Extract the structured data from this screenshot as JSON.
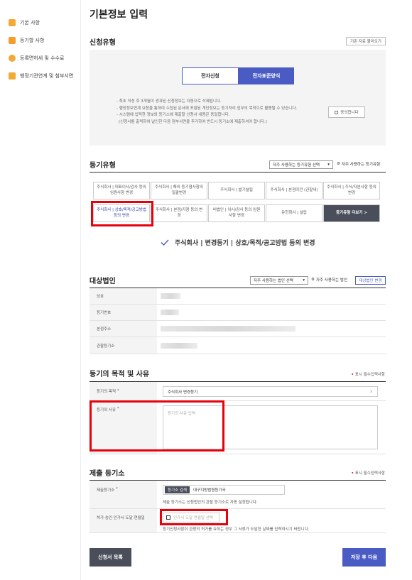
{
  "sidebar": {
    "items": [
      {
        "label": "기본 사항",
        "icon": "list-icon"
      },
      {
        "label": "등기할 사항",
        "icon": "pencil-icon"
      },
      {
        "label": "등록면허세 및 수수료",
        "icon": "coin-icon"
      },
      {
        "label": "행정기관연계 및 첨부서면",
        "icon": "attachment-icon"
      }
    ]
  },
  "page": {
    "title": "기본정보 입력"
  },
  "apply_type": {
    "title": "신청유형",
    "load_button": "기존 자료 불러오기",
    "tabs": [
      "전자신청",
      "전자표준양식"
    ],
    "selected_tab": "전자표준양식",
    "notices": [
      "- 최초 작성 후 3개월이 경과된 신청정보는 자동으로 삭제됩니다.",
      "- 행정정보연계 요청을 통하여 수집된 문서에 포함된 개인정보는 등기처리 업무의 목적으로 활용될 수 있습니다.",
      "- 시스템에 입력한 정보와 등기소에 제출할 신청서 내용은 동일합니다.",
      "(신청서를 출력하여 날인한 다음 첨부서면을 추가하여 반드시 등기소에 제출하셔야 합니다.)"
    ],
    "agree_button": "동의합니다"
  },
  "reg_type": {
    "title": "등기유형",
    "select_placeholder": "자주 사용하는 등기유형 선택",
    "favorite_label": "자주 사용하는 등기유형",
    "cells_row1": [
      "주식회사 | 대표이사/감사 등의 임원사항 변경",
      "주식회사 | 해외 등기형사항의 일괄변경",
      "주식회사 | 발기설립",
      "주식회사 | 본점이전 (관할내)",
      "주식회사 | 주식/자본사항 등의 변경"
    ],
    "cells_row2": [
      "주식회사 | 상호/목적/공고방법 등의 변경",
      "주식회사 | 본점/지점 등의 변경",
      "비법인 | 이사/감사 등의 임원사항 변경",
      "유한회사 | 설립",
      "등기유형 더보기 >"
    ],
    "selected": "주식회사 | 변경등기 | 상호/목적/공고방법 등의 변경"
  },
  "company": {
    "title": "대상법인",
    "select_placeholder": "자주 사용하는 법인 선택",
    "favorite_label": "자주 사용하는 법인",
    "register_button": "대상법인 변경",
    "rows": [
      "상호",
      "등기번호",
      "본점주소",
      "관할등기소"
    ]
  },
  "purpose": {
    "title": "등기의 목적 및 사유",
    "required_note": "표시 필수입력사항",
    "purpose_label": "등기의 목적",
    "purpose_value": "주식회사 변경등기",
    "reason_label": "등기의 사유",
    "reason_placeholder": "등기의 사유 입력"
  },
  "office": {
    "title": "제출 등기소",
    "required_note": "표시 필수입력사항",
    "office_label": "제출등기소",
    "search_button": "등기소 검색",
    "office_value": "대구지방법원등기국",
    "office_help": "제출 등기소는 신청법인의 관할 등기소로 자동 설정됩니다.",
    "date_label": "허가·승인·인가서 도달 연월일",
    "date_placeholder": "인가서 도달 연월일 선택",
    "date_help": "등기신청사항이 관청의 허가를 요하는 경우 그 서류가 도달한 날짜를 입력하시기 바랍니다."
  },
  "footer": {
    "list_button": "신청서 목록",
    "save_button": "저장 후 다음"
  },
  "colors": {
    "accent": "#4a5bc4",
    "dark_button": "#4a4e5a",
    "highlight": "#e8000b"
  }
}
